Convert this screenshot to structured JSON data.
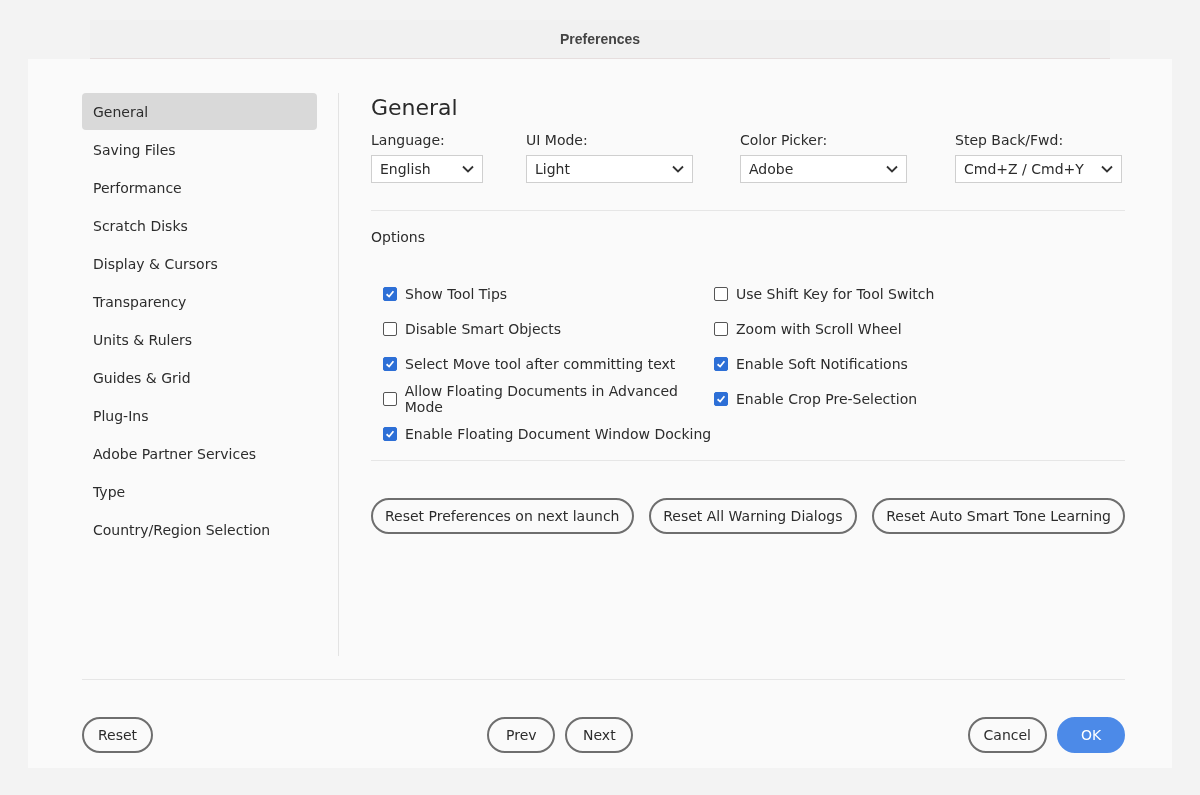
{
  "window": {
    "title": "Preferences"
  },
  "sidebar": {
    "items": [
      {
        "label": "General",
        "selected": true
      },
      {
        "label": "Saving Files",
        "selected": false
      },
      {
        "label": "Performance",
        "selected": false
      },
      {
        "label": "Scratch Disks",
        "selected": false
      },
      {
        "label": "Display & Cursors",
        "selected": false
      },
      {
        "label": "Transparency",
        "selected": false
      },
      {
        "label": "Units & Rulers",
        "selected": false
      },
      {
        "label": "Guides & Grid",
        "selected": false
      },
      {
        "label": "Plug-Ins",
        "selected": false
      },
      {
        "label": "Adobe Partner Services",
        "selected": false
      },
      {
        "label": "Type",
        "selected": false
      },
      {
        "label": "Country/Region Selection",
        "selected": false
      }
    ]
  },
  "content": {
    "heading": "General",
    "dropdowns": [
      {
        "label": "Language:",
        "value": "English"
      },
      {
        "label": "UI Mode:",
        "value": "Light"
      },
      {
        "label": "Color Picker:",
        "value": "Adobe"
      },
      {
        "label": "Step Back/Fwd:",
        "value": "Cmd+Z / Cmd+Y"
      }
    ],
    "options_heading": "Options",
    "option_columns": [
      [
        {
          "label": "Show Tool Tips",
          "checked": true
        },
        {
          "label": "Disable Smart Objects",
          "checked": false
        },
        {
          "label": "Select Move tool after committing text",
          "checked": true
        },
        {
          "label": "Allow Floating Documents in Advanced Mode",
          "checked": false
        },
        {
          "label": "Enable Floating Document Window Docking",
          "checked": true
        }
      ],
      [
        {
          "label": "Use Shift Key for Tool Switch",
          "checked": false
        },
        {
          "label": "Zoom with Scroll Wheel",
          "checked": false
        },
        {
          "label": "Enable Soft Notifications",
          "checked": true
        },
        {
          "label": "Enable Crop Pre-Selection",
          "checked": true
        }
      ]
    ],
    "reset_buttons": [
      "Reset Preferences on next launch",
      "Reset All Warning Dialogs",
      "Reset Auto Smart Tone Learning"
    ]
  },
  "footer": {
    "left": [
      "Reset"
    ],
    "center": [
      "Prev",
      "Next"
    ],
    "right": [
      {
        "label": "Cancel",
        "kind": "secondary"
      },
      {
        "label": "OK",
        "kind": "primary"
      }
    ]
  }
}
